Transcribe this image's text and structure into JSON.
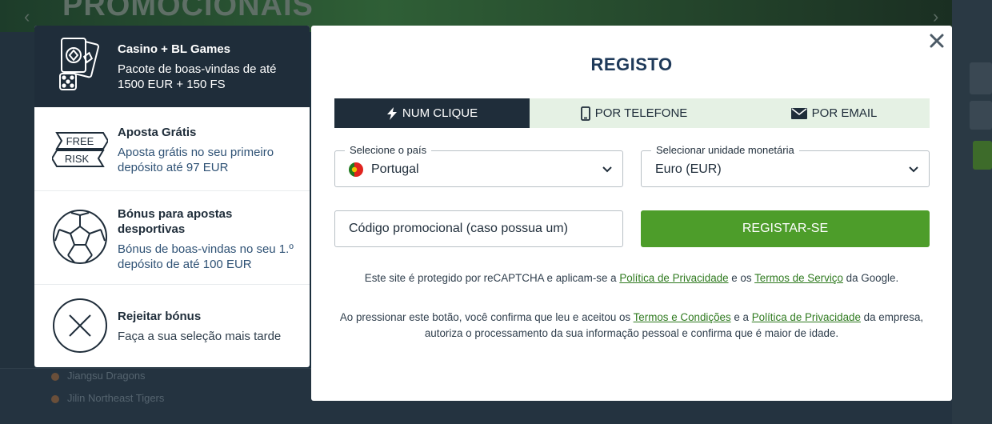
{
  "background": {
    "banner_title": "PROMOCIONAIS",
    "rows": [
      "Jiangsu Dragons",
      "Jilin Northeast Tigers"
    ]
  },
  "bonuses": [
    {
      "title": "Casino + BL Games",
      "desc": "Pacote de boas-vindas de até 1500 EUR + 150 FS",
      "icon": "cards-dice-icon",
      "active": true
    },
    {
      "title": "Aposta Grátis",
      "desc": "Aposta grátis no seu primeiro depósito até 97 EUR",
      "icon": "free-risk-icon",
      "icon_text": [
        "FREE",
        "RISK"
      ]
    },
    {
      "title": "Bónus para apostas desportivas",
      "desc": "Bónus de boas-vindas no seu 1.º depósito de até 100 EUR",
      "icon": "soccer-ball-icon"
    },
    {
      "title": "Rejeitar bónus",
      "desc": "Faça a sua seleção mais tarde",
      "icon": "reject-x-icon"
    }
  ],
  "modal": {
    "title": "REGISTO",
    "tabs": [
      {
        "label": "NUM CLIQUE",
        "icon": "lightning-icon",
        "active": true
      },
      {
        "label": "POR TELEFONE",
        "icon": "phone-icon"
      },
      {
        "label": "POR EMAIL",
        "icon": "envelope-icon"
      }
    ],
    "country": {
      "label": "Selecione o país",
      "value": "Portugal"
    },
    "currency": {
      "label": "Selecionar unidade monetária",
      "value": "Euro (EUR)"
    },
    "promo_placeholder": "Código promocional (caso possua um)",
    "register_label": "REGISTAR-SE",
    "recaptcha": {
      "before": "Este site é protegido por reCAPTCHA e aplicam-se a ",
      "privacy_link": "Política de Privacidade",
      "middle": " e os ",
      "terms_link": "Termos de Serviço",
      "after": " da Google."
    },
    "consent": {
      "before": "Ao pressionar este botão, você confirma que leu e aceitou os ",
      "terms_link": "Termos e Condições",
      "middle": " e a ",
      "privacy_link": "Política de Privacidade",
      "after": " da empresa, autoriza o processamento da sua informação pessoal e confirma que é maior de idade."
    }
  },
  "colors": {
    "accent_green": "#4d9d2a",
    "dark_navy": "#1f2d3a",
    "tab_light": "#e5f1e4",
    "link_green": "#2f7a1f"
  }
}
